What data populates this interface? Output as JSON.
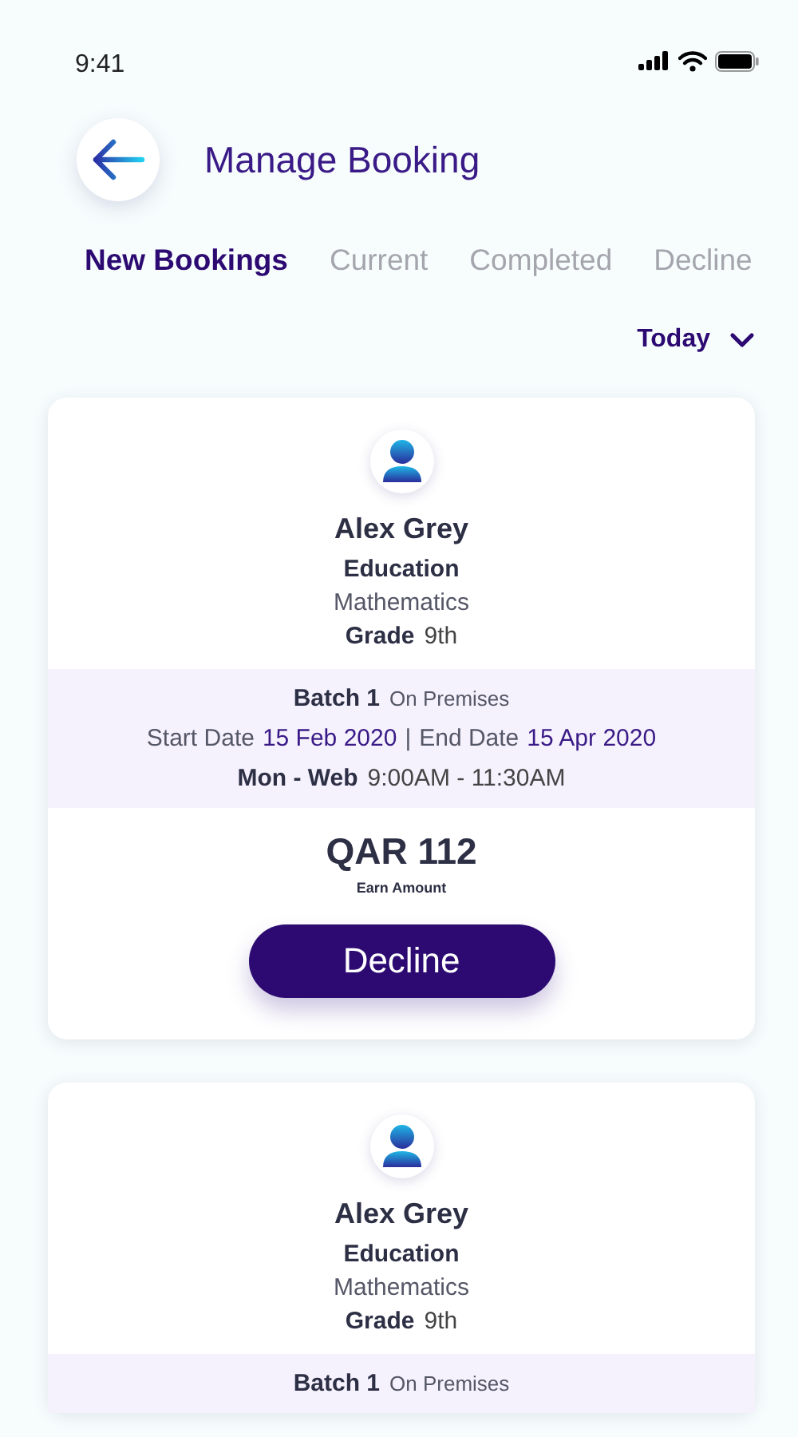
{
  "status_bar": {
    "time": "9:41"
  },
  "header": {
    "title": "Manage Booking"
  },
  "tabs": [
    {
      "label": "New Bookings",
      "selected": true
    },
    {
      "label": "Current",
      "selected": false
    },
    {
      "label": "Completed",
      "selected": false
    },
    {
      "label": "Decline",
      "selected": false
    }
  ],
  "filter": {
    "label": "Today"
  },
  "bookings": [
    {
      "name": "Alex Grey",
      "category": "Education",
      "subject": "Mathematics",
      "grade_label": "Grade",
      "grade": "9th",
      "batch": "Batch 1",
      "mode": "On Premises",
      "start_label": "Start Date",
      "start_date": "15 Feb 2020",
      "separator": "|",
      "end_label": "End Date",
      "end_date": "15 Apr 2020",
      "days": "Mon - Web",
      "time": "9:00AM - 11:30AM",
      "amount": "QAR 112",
      "amount_label": "Earn Amount",
      "action": "Decline"
    },
    {
      "name": "Alex Grey",
      "category": "Education",
      "subject": "Mathematics",
      "grade_label": "Grade",
      "grade": "9th",
      "batch": "Batch 1",
      "mode": "On Premises"
    }
  ]
}
